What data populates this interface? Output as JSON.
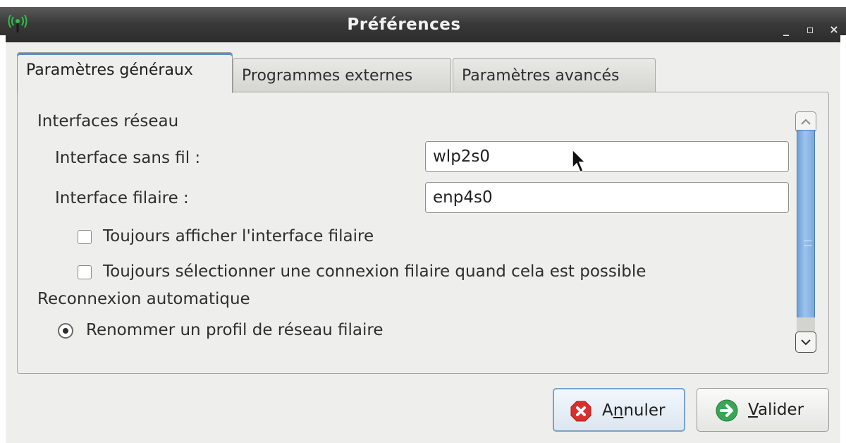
{
  "window": {
    "title": "Préférences",
    "controls": {
      "minimize": "_",
      "maximize": "▫",
      "close": "×"
    }
  },
  "tabs": [
    {
      "label": "Paramètres généraux",
      "active": true
    },
    {
      "label": "Programmes externes",
      "active": false
    },
    {
      "label": "Paramètres avancés",
      "active": false
    }
  ],
  "network": {
    "section_label": "Interfaces réseau",
    "wireless_label": "Interface sans fil :",
    "wireless_value": "wlp2s0",
    "wired_label": "Interface filaire :",
    "wired_value": "enp4s0",
    "always_show_wired": {
      "label": "Toujours afficher l'interface filaire",
      "checked": false
    },
    "always_select_wired": {
      "label": "Toujours sélectionner une connexion filaire quand cela est possible",
      "checked": false
    }
  },
  "reconnect": {
    "section_label": "Reconnexion automatique",
    "rename_profile": {
      "label": "Renommer un profil de réseau filaire",
      "selected": true
    }
  },
  "buttons": {
    "cancel": {
      "mnemonic_pre": "A",
      "mnemonic": "n",
      "mnemonic_post": "nuler"
    },
    "ok": {
      "mnemonic_pre": "",
      "mnemonic": "V",
      "mnemonic_post": "alider"
    }
  },
  "colors": {
    "titlebar": "#3a3a3a",
    "accent": "#5d8fc6",
    "scrollbar": "#8fb8e6",
    "cancel_icon": "#d9302e",
    "ok_icon": "#3aa655"
  },
  "icons": {
    "app": "wireless-antenna-icon",
    "cancel": "cancel-x-icon",
    "ok": "ok-arrow-icon"
  }
}
